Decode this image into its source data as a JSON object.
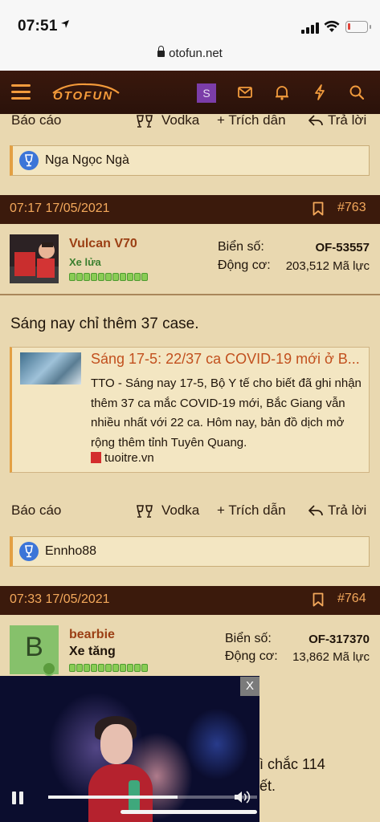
{
  "status_bar": {
    "time": "07:51",
    "url": "otofun.net",
    "battery_level": 0.15
  },
  "nav": {
    "logo_text": "OTOFUN",
    "s_badge": "S",
    "brand_color": "#f29b3d",
    "icons": [
      "menu-icon",
      "mail-icon",
      "bell-icon",
      "lightning-icon",
      "search-icon"
    ]
  },
  "prev_post": {
    "actions": {
      "report": "Báo cáo",
      "vodka": "Vodka",
      "quote": "+ Trích dẫn",
      "reply": "Trả lời"
    },
    "liked_by": "Nga Ngọc Ngà"
  },
  "post_763": {
    "datetime": "07:17 17/05/2021",
    "number": "#763",
    "username": "Vulcan V70",
    "rank": "Xe lửa",
    "rank_dots": 11,
    "plate_label": "Biển số:",
    "plate_value": "OF-53557",
    "engine_label": "Động cơ:",
    "engine_value": "203,512 Mã lực",
    "text": "Sáng nay chỉ thêm 37 case.",
    "preview": {
      "title": "Sáng 17-5: 22/37 ca COVID-19 mới ở B...",
      "description": "TTO - Sáng nay 17-5, Bộ Y tế cho biết đã ghi nhận thêm 37 ca mắc COVID-19 mới, Bắc Giang vẫn nhiều nhất với 22 ca. Hôm nay, bản đồ dịch mở rộng thêm tỉnh Tuyên Quang.",
      "source": "tuoitre.vn"
    },
    "actions": {
      "report": "Báo cáo",
      "vodka": "Vodka",
      "quote": "+ Trích dẫn",
      "reply": "Trả lời"
    },
    "liked_by": "Ennho88"
  },
  "post_764": {
    "datetime": "07:33 17/05/2021",
    "number": "#764",
    "avatar_letter": "B",
    "username": "bearbie",
    "rank": "Xe tăng",
    "rank_dots": 11,
    "plate_label": "Biển số:",
    "plate_value": "OF-317370",
    "engine_label": "Động cơ:",
    "engine_value": "13,862 Mã lực",
    "partial_line1": "ì chắc 114",
    "partial_line2": "ết."
  },
  "video_pip": {
    "close_label": "X",
    "progress": 0.62
  }
}
